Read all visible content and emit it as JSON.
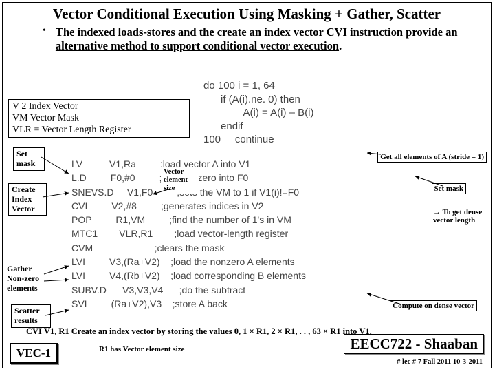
{
  "title": "Vector Conditional Execution Using Masking + Gather, Scatter",
  "bullet": {
    "pre": "The ",
    "u1": "indexed loads-stores",
    "mid1": " and the ",
    "u2": "create an index vector CVI",
    "mid2": " instruction provide ",
    "u3": "an alternative method to support conditional vector execution",
    "tail": "."
  },
  "defs": {
    "l1": "V 2 Index Vector",
    "l2": "VM Vector Mask",
    "l3": "VLR = Vector Length Register"
  },
  "labels": {
    "setmask1": "Set",
    "setmask2": "mask",
    "createidx1": "Create",
    "createidx2": "Index",
    "createidx3": "Vector",
    "gather1": "Gather",
    "gather2": "Non-zero",
    "gather3": "elements",
    "scatter1": "Scatter",
    "scatter2": "results",
    "vecsize1": "Vector",
    "vecsize2": "element",
    "vecsize3": "size"
  },
  "rightnotes": {
    "getall": "Get all elements of A (stride = 1)",
    "setmask": "Set mask",
    "dense": "To get dense vector length",
    "compute": "Compute on dense vector"
  },
  "code_top": "do 100 i = 1, 64\n      if (A(i).ne. 0) then\n              A(i) = A(i) – B(i)\n      endif\n100     continue",
  "code_main": "LV          V1,Ra         ;load vector A into V1\nL.D         F0,#0         ;load FP zero into F0\nSNEVS.D     V1,F0         ;sets the VM to 1 if V1(i)!=F0\nCVI         V2,#8         ;generates indices in V2\nPOP         R1,VM         ;find the number of 1's in VM\nMTC1        VLR,R1        ;load vector-length register\nCVM                       ;clears the mask\nLVI         V3,(Ra+V2)    ;load the nonzero A elements\nLVI         V4,(Rb+V2)    ;load corresponding B elements\nSUBV.D      V3,V3,V4      ;do the subtract\nSVI         (Ra+V2),V3    ;store A back",
  "footer": "CVI V1, R1  Create an index vector by storing the values 0, 1 × R1, 2 × R1, . . , 63 × R1 into V1.",
  "r1note": "R1 has Vector element size",
  "vec1": "VEC-1",
  "course": "EECC722 - Shaaban",
  "lec": "#  lec # 7    Fall 2011   10-3-2011"
}
